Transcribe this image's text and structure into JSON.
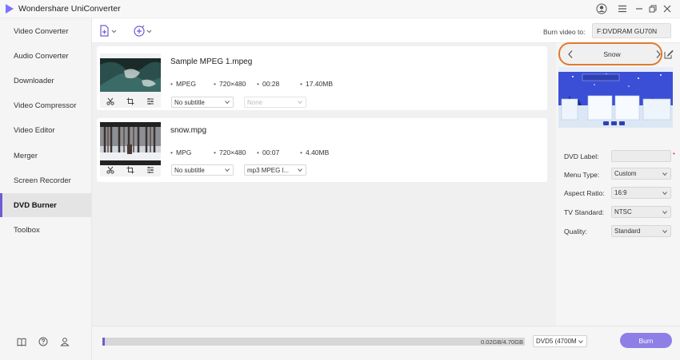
{
  "window": {
    "title": "Wondershare UniConverter",
    "accent": "#6b5dd3",
    "burn_color": "#8d7fe6",
    "highlight": "#e07a2e"
  },
  "sidebar": {
    "items": [
      {
        "label": "Video Converter"
      },
      {
        "label": "Audio Converter"
      },
      {
        "label": "Downloader"
      },
      {
        "label": "Video Compressor"
      },
      {
        "label": "Video Editor"
      },
      {
        "label": "Merger"
      },
      {
        "label": "Screen Recorder"
      },
      {
        "label": "DVD Burner",
        "active": true
      },
      {
        "label": "Toolbox"
      }
    ],
    "footer_icons": [
      "book-icon",
      "help-icon",
      "user-icon"
    ]
  },
  "toolbar": {
    "burn_to_label": "Burn video to:",
    "burn_to_value": "F:DVDRAM GU70N",
    "icons": [
      "add-file-icon",
      "add-media-icon"
    ]
  },
  "files": [
    {
      "name": "Sample MPEG 1.mpeg",
      "format": "MPEG",
      "resolution": "720×480",
      "duration": "00:28",
      "size": "17.40MB",
      "subtitle": "No subtitle",
      "audio": "None",
      "audio_disabled": true
    },
    {
      "name": "snow.mpg",
      "format": "MPG",
      "resolution": "720×480",
      "duration": "00:07",
      "size": "4.40MB",
      "subtitle": "No subtitle",
      "audio": "mp3 MPEG l...",
      "audio_disabled": false
    }
  ],
  "template": {
    "name": "Snow",
    "preview_title": "— — —"
  },
  "options": {
    "dvd_label": {
      "label": "DVD Label:",
      "value": ""
    },
    "menu_type": {
      "label": "Menu Type:",
      "value": "Custom"
    },
    "aspect_ratio": {
      "label": "Aspect Ratio:",
      "value": "16:9"
    },
    "tv_standard": {
      "label": "TV Standard:",
      "value": "NTSC"
    },
    "quality": {
      "label": "Quality:",
      "value": "Standard"
    }
  },
  "bottom": {
    "progress_text": "0.02GB/4.70GB",
    "progress_fraction": 0.004,
    "disc_type": "DVD5 (4700M",
    "burn_label": "Burn"
  }
}
